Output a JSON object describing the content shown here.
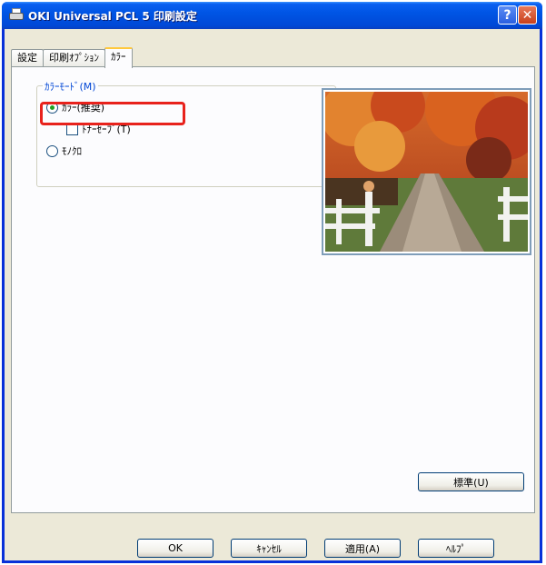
{
  "window": {
    "title": "OKI Universal PCL 5 印刷設定"
  },
  "titlebar_buttons": {
    "help": "?",
    "close": "✕"
  },
  "tabs": [
    {
      "label": "設定"
    },
    {
      "label": "印刷ｵﾌﾟｼｮﾝ"
    },
    {
      "label": "ｶﾗｰ",
      "active": true
    }
  ],
  "color_mode": {
    "group_label": "ｶﾗｰﾓｰﾄﾞ(M)",
    "options": [
      {
        "label": "ｶﾗｰ(推奨)",
        "checked": true
      },
      {
        "label": "ﾓﾉｸﾛ",
        "checked": false
      }
    ],
    "toner_save": {
      "label": "ﾄﾅｰｾｰﾌﾞ(T)",
      "checked": false
    }
  },
  "preview": {
    "image": "autumn-trees-road-photo"
  },
  "buttons": {
    "default": "標準(U)",
    "ok": "OK",
    "cancel": "ｷｬﾝｾﾙ",
    "apply": "適用(A)",
    "help": "ﾍﾙﾌﾟ"
  },
  "colors": {
    "highlight": "#e8221c",
    "titlebar": "#0055e5",
    "group_label": "#0046d5"
  }
}
